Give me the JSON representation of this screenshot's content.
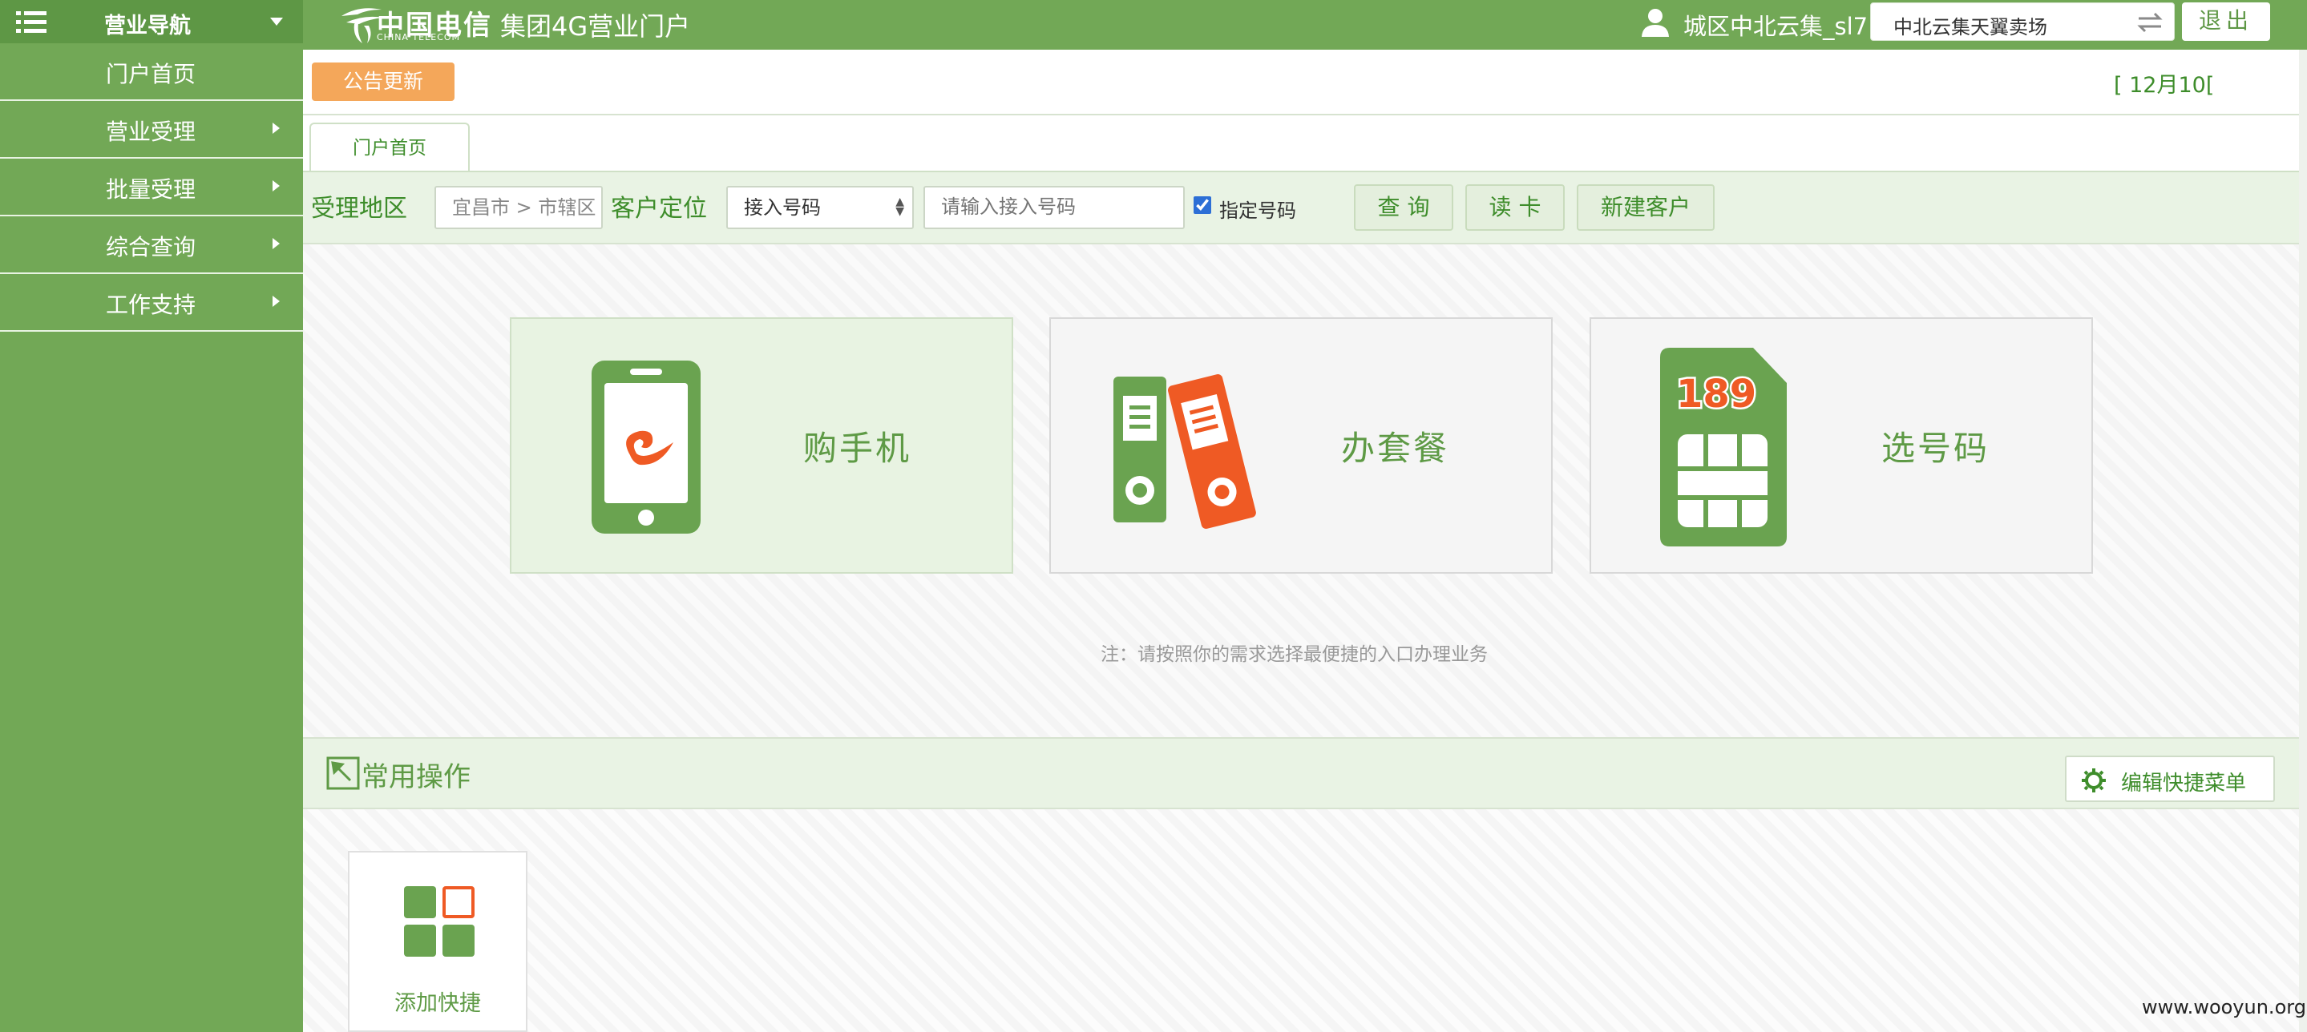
{
  "sidebar": {
    "title": "营业导航",
    "items": [
      {
        "label": "门户首页"
      },
      {
        "label": "营业受理"
      },
      {
        "label": "批量受理"
      },
      {
        "label": "综合查询"
      },
      {
        "label": "工作支持"
      }
    ]
  },
  "header": {
    "brand_cn": "中国电信",
    "brand_en": "CHINA TELECOM",
    "portal_title": "集团4G营业门户",
    "user_name": "城区中北云集_sl7",
    "store": "中北云集天翼卖场",
    "logout_label": "退出"
  },
  "notice": {
    "button_label": "公告更新",
    "date_text": "[ 12月10["
  },
  "tabs": [
    {
      "label": "门户首页"
    }
  ],
  "search": {
    "region_label": "受理地区",
    "region_value": "宜昌市 > 市辖区",
    "locate_label": "客户定位",
    "type_value": "接入号码",
    "number_placeholder": "请输入接入号码",
    "check_label": "指定号码",
    "query_label": "查 询",
    "read_card_label": "读 卡",
    "new_customer_label": "新建客户"
  },
  "cards": [
    {
      "label": "购手机",
      "icon": "phone-icon"
    },
    {
      "label": "办套餐",
      "icon": "binders-icon"
    },
    {
      "label": "选号码",
      "icon": "sim-card-icon"
    }
  ],
  "note": "注：请按照你的需求选择最便捷的入口办理业务",
  "quick_ops": {
    "title": "常用操作",
    "edit_label": "编辑快捷菜单",
    "add_label": "添加快捷"
  },
  "sim_number": "189",
  "watermark": "www.wooyun.org",
  "colors": {
    "brand_green": "#72a856",
    "dark_green": "#5e9745",
    "accent_orange": "#f4a75a",
    "icon_orange": "#ef5a24"
  }
}
